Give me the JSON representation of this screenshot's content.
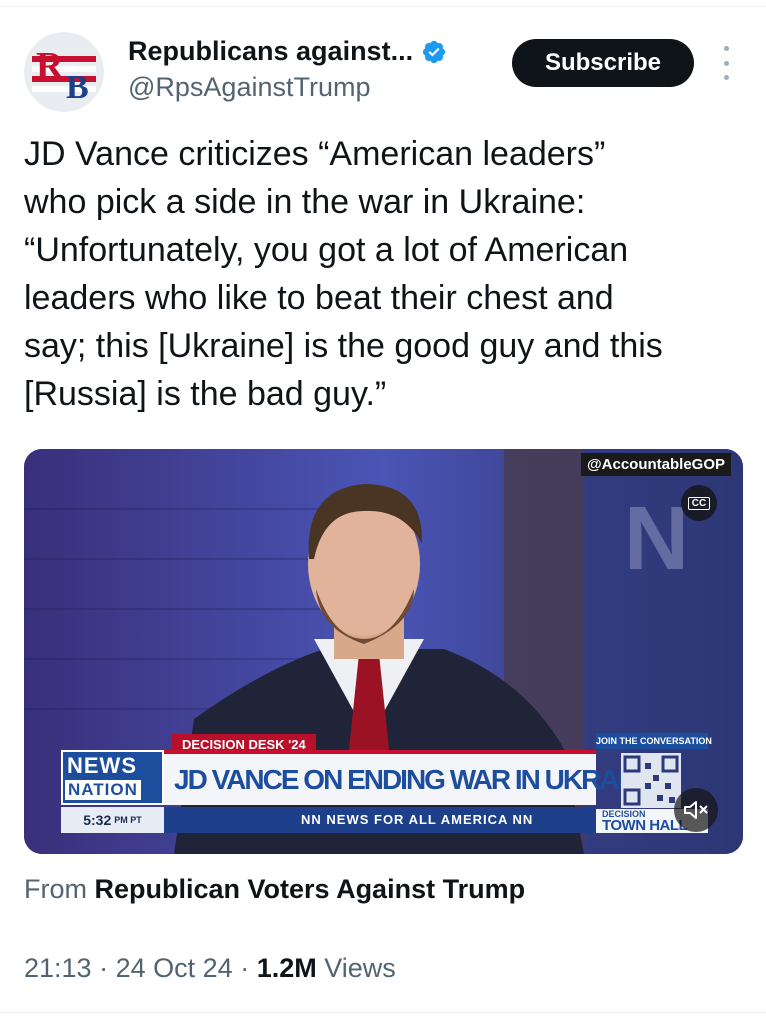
{
  "header": {
    "avatar_letters": [
      "R",
      "B"
    ],
    "name": "Republicans against...",
    "handle": "@RpsAgainstTrump",
    "subscribe_label": "Subscribe",
    "more_icon": "more-vertical-icon",
    "verified_icon": "verified-badge-icon"
  },
  "tweet": {
    "lines": [
      "JD Vance criticizes “American leaders”",
      "who pick a side in the war in Ukraine:",
      "“Unfortunately, you got a lot of American",
      "leaders who like to beat their chest and",
      "say; this [Ukraine] is the good guy and this",
      "[Russia] is the bad guy.”"
    ]
  },
  "media": {
    "watermark": "@AccountableGOP",
    "cc_label": "CC",
    "mute_icon": "speaker-muted-icon",
    "lower_third": {
      "tag": "DECISION DESK '24",
      "logo_top": "NEWS",
      "logo_bottom": "NATION",
      "headline": "JD VANCE ON ENDING WAR IN UKRAINE",
      "time": "5:32",
      "time_suffix": "PM PT",
      "tagline": "NN NEWS FOR ALL AMERICA NN",
      "join_label": "JOIN THE CONVERSATION",
      "town_top": "DECISION",
      "town_bottom": "TOWN HALL"
    }
  },
  "footer": {
    "from_prefix": "From",
    "from_source": "Republican Voters Against Trump",
    "time": "21:13",
    "separator": "·",
    "date": "24 Oct 24",
    "views_count": "1.2M",
    "views_label": "Views"
  },
  "colors": {
    "text_primary": "#0f1419",
    "text_secondary": "#536471",
    "verified": "#1d9bf0",
    "subscribe_bg": "#0f1419",
    "news_blue": "#1d4e9e",
    "news_red": "#c8102e"
  }
}
